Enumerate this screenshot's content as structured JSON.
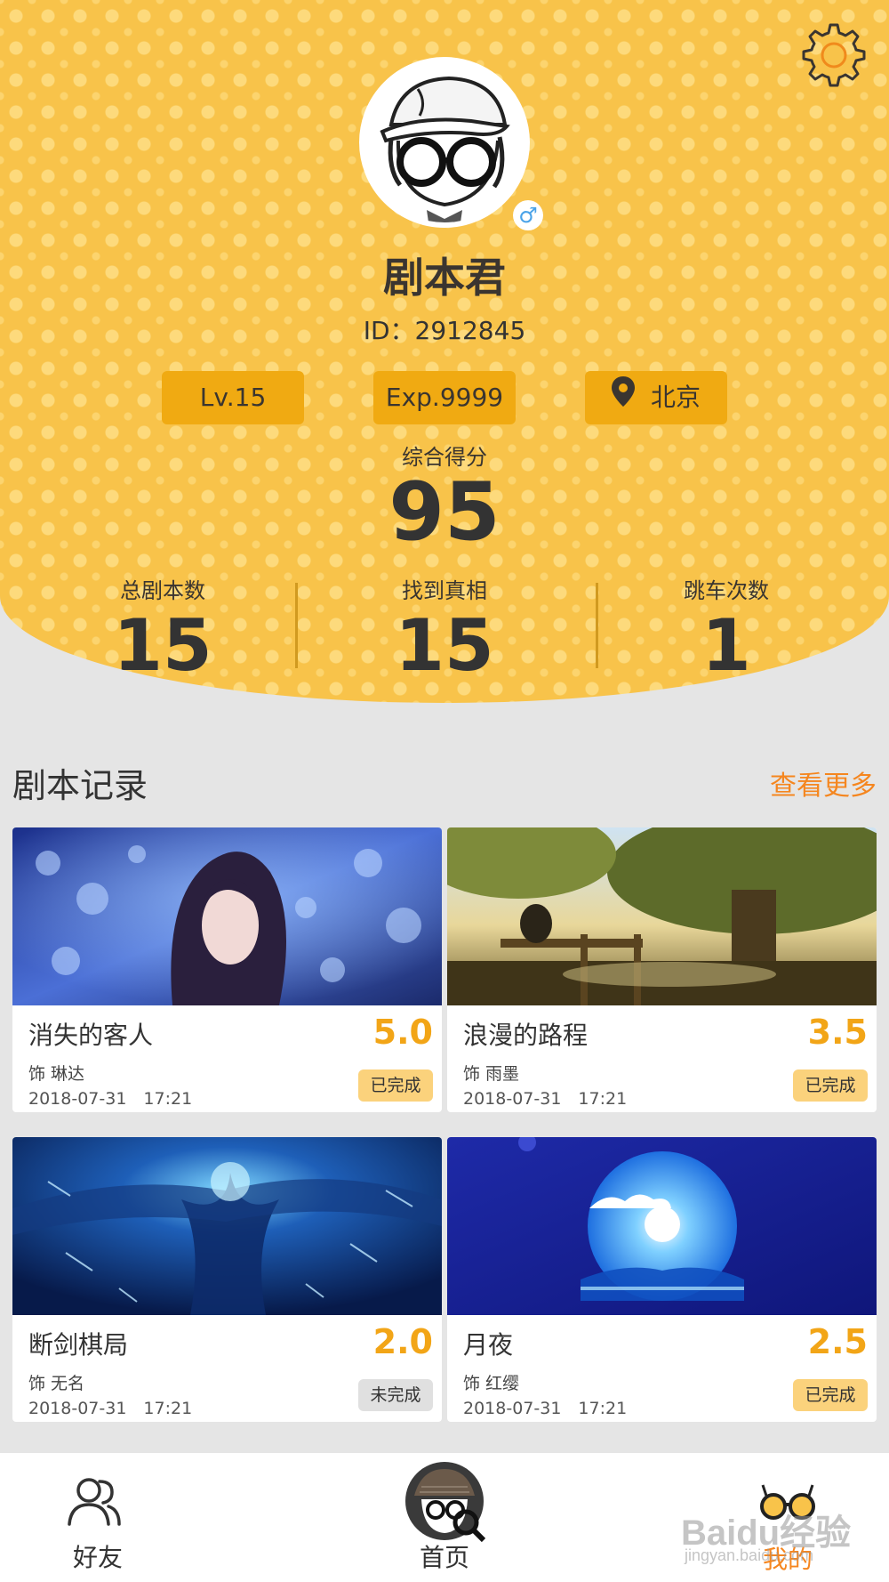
{
  "profile": {
    "name": "剧本君",
    "id_text": "ID：2912845",
    "gender_symbol": "♂",
    "level": "Lv.15",
    "exp": "Exp.9999",
    "city": "北京"
  },
  "score": {
    "label": "综合得分",
    "value": "95"
  },
  "stats": [
    {
      "label": "总剧本数",
      "value": "15"
    },
    {
      "label": "找到真相",
      "value": "15"
    },
    {
      "label": "跳车次数",
      "value": "1"
    }
  ],
  "records": {
    "title": "剧本记录",
    "more_label": "查看更多",
    "items": [
      {
        "title": "消失的客人",
        "score": "5.0",
        "role": "饰 琳达",
        "date": "2018-07-31　17:21",
        "status": "已完成"
      },
      {
        "title": "浪漫的路程",
        "score": "3.5",
        "role": "饰 雨墨",
        "date": "2018-07-31　17:21",
        "status": "已完成"
      },
      {
        "title": "断剑棋局",
        "score": "2.0",
        "role": "饰 无名",
        "date": "2018-07-31　17:21",
        "status": "未完成"
      },
      {
        "title": "月夜",
        "score": "2.5",
        "role": "饰 红缨",
        "date": "2018-07-31　17:21",
        "status": "已完成"
      }
    ]
  },
  "nav": {
    "friends": "好友",
    "home": "首页",
    "mine": "我的",
    "active_color": "#f5861f"
  },
  "watermark": {
    "brand": "Baidu经验",
    "url": "jingyan.baidu.com"
  },
  "colors": {
    "header_bg": "#f8c34a",
    "pill_bg": "#f0aa12",
    "accent_orange": "#f5861f",
    "score_yellow": "#f2a517"
  }
}
